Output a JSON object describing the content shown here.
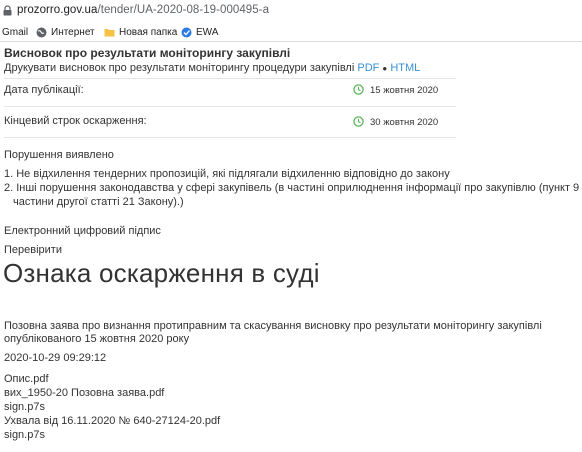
{
  "browser": {
    "url_host": "prozorro.gov.ua",
    "url_path": "/tender/UA-2020-08-19-000495-a",
    "bookmarks": [
      {
        "label": "Gmail",
        "icon": "gmail-icon"
      },
      {
        "label": "Интернет",
        "icon": "globe-icon"
      },
      {
        "label": "Новая папка",
        "icon": "folder-icon"
      },
      {
        "label": "EWA",
        "icon": "ewa-icon"
      }
    ]
  },
  "report": {
    "title": "Висновок про результати моніторингу закупівлі",
    "print_text": "Друкувати висновок про результати моніторингу процедури закупівлі",
    "print_pdf": "PDF",
    "print_bullet": "●",
    "print_html": "HTML",
    "publication_label": "Дата публікації:",
    "publication_date": "15 жовтня 2020",
    "appeal_deadline_label": "Кінцевий строк оскарження:",
    "appeal_deadline_date": "30 жовтня 2020",
    "violations_heading": "Порушення виявлено",
    "violations": [
      "1. Не відхилення тендерних пропозицій, які підлягали відхиленню відповідно до закону",
      "2. Інші порушення законодавства у сфері закупівель (в частині оприлюднення інформації про закупівлю (пункт 9",
      "частини другої статті 21 Закону).)"
    ],
    "signature_link": "Електронний цифровий підпис",
    "verify_link": "Перевірити"
  },
  "court": {
    "heading": "Ознака оскарження в суді",
    "claim_line1": "Позовна заява про визнання протиправним та скасування висновку про результати моніторингу закупівлі",
    "claim_line2": "опублікованого 15 жовтня 2020 року",
    "timestamp": "2020-10-29 09:29:12",
    "files": [
      "Опис.pdf",
      "вих_1950-20 Позовна заява.pdf",
      "sign.p7s",
      "Ухвала від 16.11.2020 № 640-27124-20.pdf",
      "sign.p7s"
    ]
  },
  "colors": {
    "link": "#3a8fd0",
    "clock_green": "#5cb85c",
    "text": "#333333"
  }
}
